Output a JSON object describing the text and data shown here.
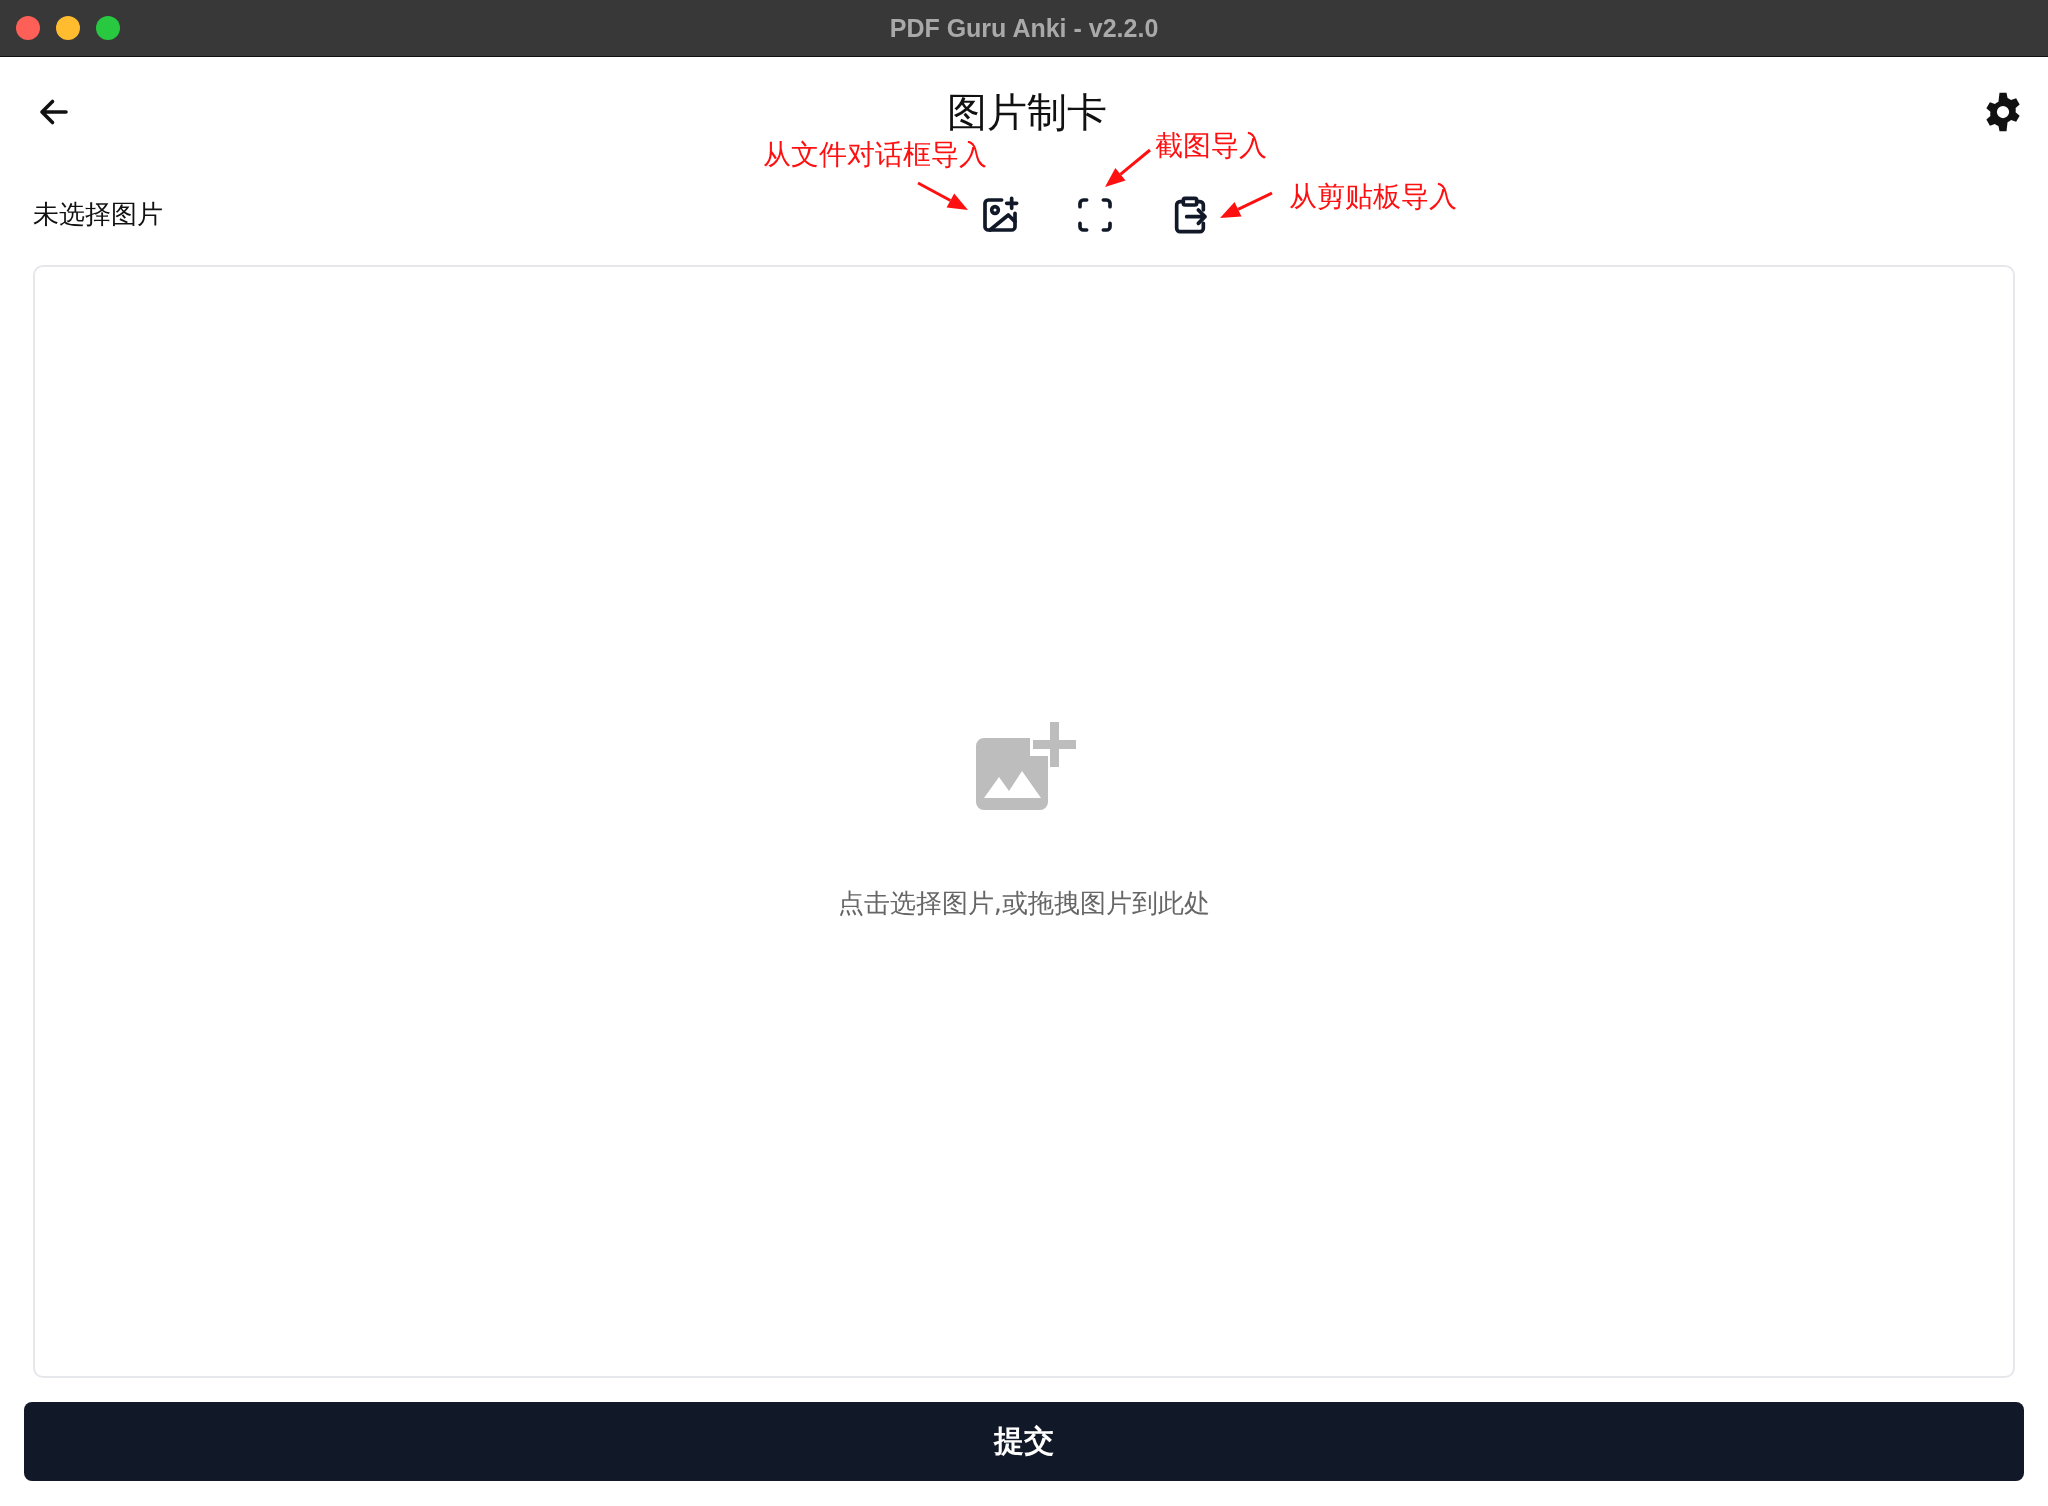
{
  "window": {
    "title": "PDF Guru Anki - v2.2.0"
  },
  "header": {
    "title": "图片制卡"
  },
  "status": "未选择图片",
  "import_buttons": [
    {
      "kind": "file"
    },
    {
      "kind": "screenshot"
    },
    {
      "kind": "clipboard"
    }
  ],
  "annotations": [
    {
      "text": "从文件对话框导入"
    },
    {
      "text": "截图导入"
    },
    {
      "text": "从剪贴板导入"
    }
  ],
  "dropzone": {
    "hint": "点击选择图片,或拖拽图片到此处"
  },
  "submit": {
    "label": "提交"
  }
}
